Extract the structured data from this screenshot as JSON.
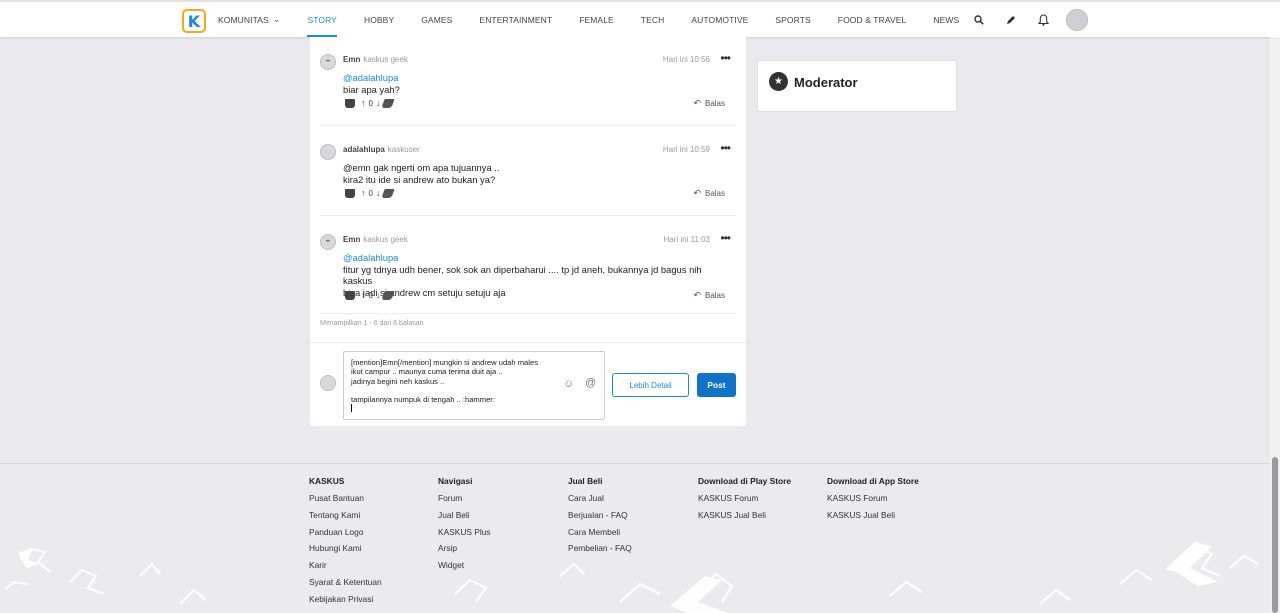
{
  "nav": {
    "logo": "K",
    "items": [
      "KOMUNITAS",
      "STORY",
      "HOBBY",
      "GAMES",
      "ENTERTAINMENT",
      "FEMALE",
      "TECH",
      "AUTOMOTIVE",
      "SPORTS",
      "FOOD & TRAVEL",
      "NEWS"
    ],
    "active": "STORY"
  },
  "comments": [
    {
      "user": "Emn",
      "rank": "kaskus geek",
      "time": "Hari ini 10:56",
      "mention": "@adalahlupa",
      "lines": [
        "biar apa yah?"
      ],
      "votes": "0",
      "reply": "Balas"
    },
    {
      "user": "adalahlupa",
      "rank": "kaskuser",
      "time": "Hari ini 10:59",
      "mention": "",
      "lines": [
        "@emn gak ngerti om apa tujuannya ..",
        "kira2 itu ide si andrew ato bukan ya?"
      ],
      "votes": "0",
      "reply": "Balas"
    },
    {
      "user": "Emn",
      "rank": "kaskus geek",
      "time": "Hari ini 11:03",
      "mention": "@adalahlupa",
      "lines": [
        "fitur yg tdnya udh bener, sok sok an diperbaharui .... tp jd aneh, bukannya jd bagus nih kaskus",
        "bisa jadi si andrew cm setuju setuju aja"
      ],
      "votes": "0",
      "reply": "Balas"
    }
  ],
  "pagination_text": "Menampilkan 1 - 6 dari 6 balasan",
  "editor": {
    "text": "[mention]Emn[/mention] mungkin si andrew udah males\nikut campur .. maunya cuma terima duit aja ..\njadinya begini neh kaskus ..\n\ntampilannya numpuk di tengah .. :hammer:\n",
    "more_label": "Lebih Detail",
    "post_label": "Post"
  },
  "moderator": {
    "title": "Moderator"
  },
  "footer": {
    "columns": [
      {
        "title": "KASKUS",
        "links": [
          "Pusat Bantuan",
          "Tentang Kami",
          "Panduan Logo",
          "Hubungi Kami",
          "Karir",
          "Syarat & Ketentuan",
          "Kebijakan Privasi"
        ]
      },
      {
        "title": "Navigasi",
        "links": [
          "Forum",
          "Jual Beli",
          "KASKUS Plus",
          "Arsip",
          "Widget"
        ]
      },
      {
        "title": "Jual Beli",
        "links": [
          "Cara Jual",
          "Berjualan - FAQ",
          "Cara Membeli",
          "Pembelian - FAQ"
        ]
      },
      {
        "title": "Download di Play Store",
        "links": [
          "KASKUS Forum",
          "KASKUS Jual Beli"
        ]
      },
      {
        "title": "Download di App Store",
        "links": [
          "KASKUS Forum",
          "KASKUS Jual Beli"
        ]
      }
    ]
  },
  "icons": [
    "search-icon",
    "pencil-icon",
    "bell-icon",
    "avatar",
    "star-icon",
    "reply-icon",
    "emoji-icon",
    "at-icon"
  ],
  "colors": {
    "accent": "#1a8ad4",
    "post_button": "#0f73c7",
    "logo_border": "#f8a61b"
  }
}
